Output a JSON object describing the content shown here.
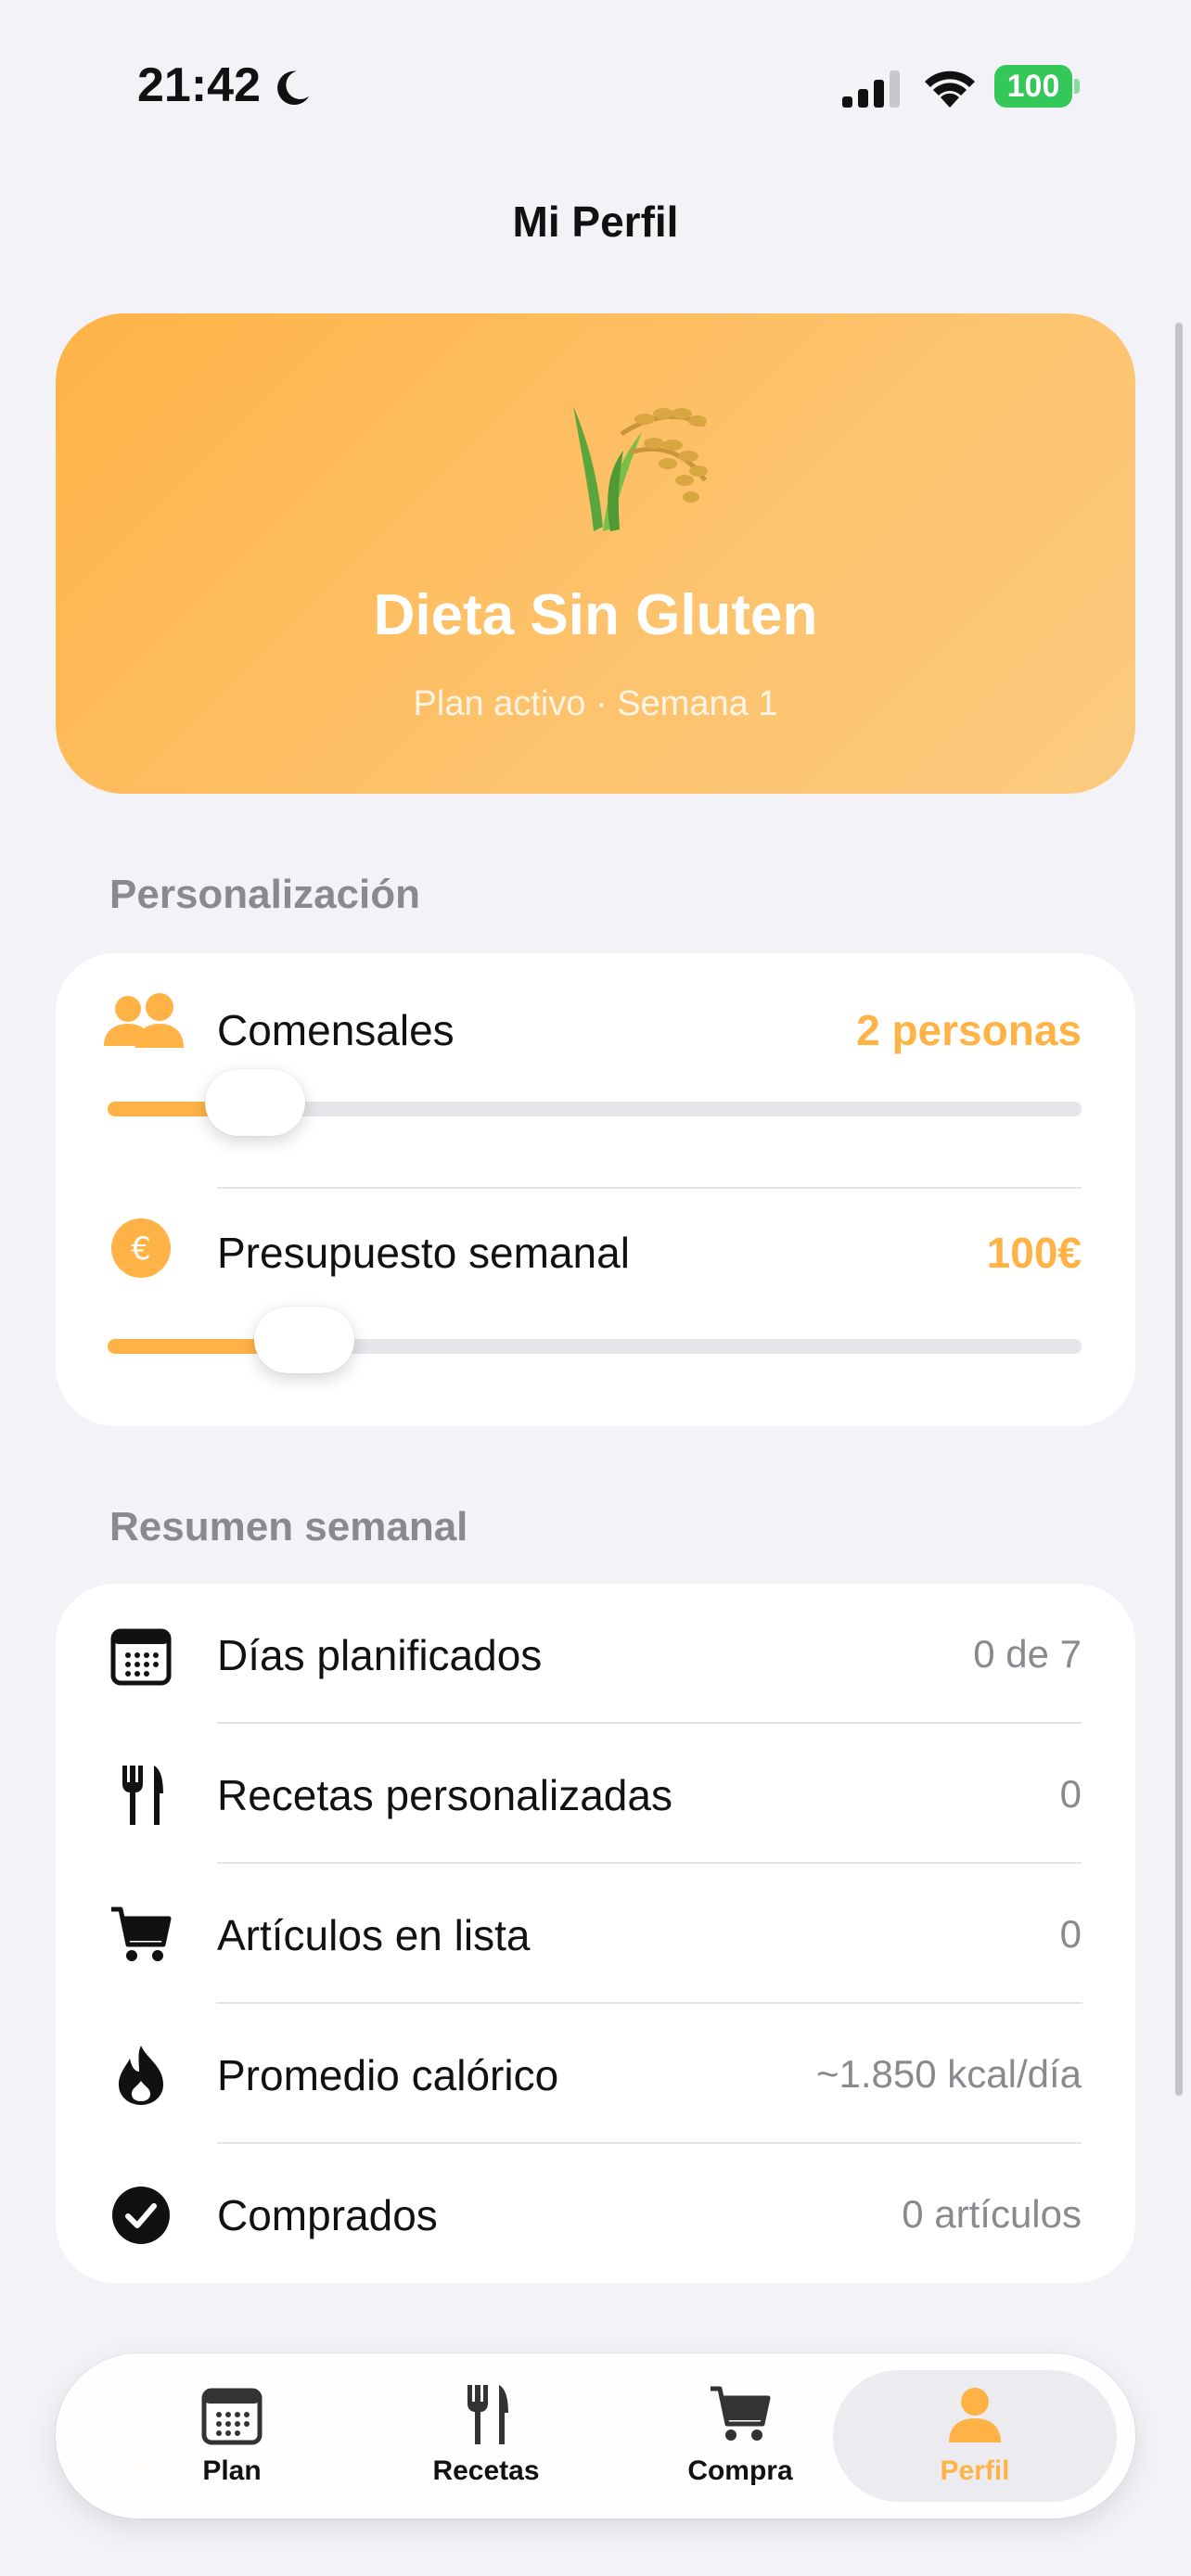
{
  "status_bar": {
    "time": "21:42",
    "battery": "100"
  },
  "nav": {
    "title": "Mi Perfil"
  },
  "hero": {
    "title": "Dieta Sin Gluten",
    "subtitle": "Plan activo · Semana 1",
    "icon": "rice-icon",
    "gradient": [
      "#ffb347",
      "#fccb80"
    ]
  },
  "personalization": {
    "header": "Personalización",
    "sliders": [
      {
        "label": "Comensales",
        "value": "2 personas",
        "icon": "people-icon",
        "level": 0.1
      },
      {
        "label": "Presupuesto semanal",
        "value": "100€",
        "icon": "euro-icon",
        "level": 0.15
      }
    ]
  },
  "summary": {
    "header": "Resumen semanal",
    "rows": [
      {
        "label": "Días planificados",
        "value": "0 de 7",
        "icon": "calendar-icon"
      },
      {
        "label": "Recetas personalizadas",
        "value": "0",
        "icon": "fork-knife-icon"
      },
      {
        "label": "Artículos en lista",
        "value": "0",
        "icon": "cart-icon"
      },
      {
        "label": "Promedio calórico",
        "value": "~1.850 kcal/día",
        "icon": "flame-icon"
      },
      {
        "label": "Comprados",
        "value": "0 artículos",
        "icon": "checkmark-circle-icon"
      }
    ]
  },
  "tabbar": {
    "tabs": [
      {
        "label": "Plan",
        "icon": "calendar-icon"
      },
      {
        "label": "Recetas",
        "icon": "fork-knife-icon"
      },
      {
        "label": "Compra",
        "icon": "cart-icon"
      },
      {
        "label": "Perfil",
        "icon": "person-icon",
        "active": true
      }
    ]
  },
  "colors": {
    "accent": "#ffb347",
    "background": "#f2f2f7",
    "secondary_text": "#8a8a8e"
  }
}
